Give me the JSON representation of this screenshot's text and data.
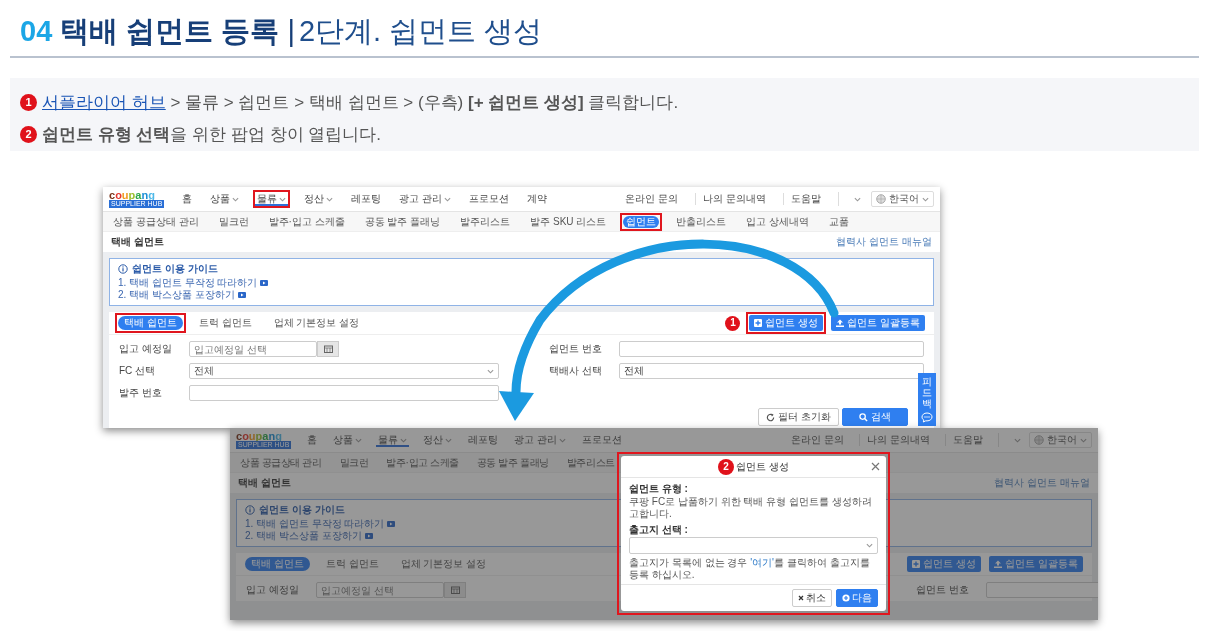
{
  "heading": {
    "number": "04",
    "title": "택배 쉽먼트 등록",
    "separator": "|",
    "subtitle": "2단계. 쉽먼트 생성"
  },
  "instructions": [
    {
      "marker": "1",
      "link": "서플라이어 허브",
      "text": " > 물류 > 쉽먼트 > 택배 쉽먼트 > (우측) **[+ 쉽먼트 생성]** 클릭합니다."
    },
    {
      "marker": "2",
      "text": "**쉽먼트 유형 선택**을 위한 팝업 창이 열립니다."
    }
  ],
  "screens": [
    {
      "dimmed": false,
      "logo": {
        "wordmark": "coupang",
        "badge": "SUPPLIER HUB"
      },
      "nav": [
        {
          "label": "홈",
          "dropdown": false,
          "selected": false,
          "highlighted": false
        },
        {
          "label": "상품",
          "dropdown": true,
          "selected": false,
          "highlighted": false
        },
        {
          "label": "물류",
          "dropdown": true,
          "selected": true,
          "highlighted": true
        },
        {
          "label": "정산",
          "dropdown": true,
          "selected": false,
          "highlighted": false
        },
        {
          "label": "레포팅",
          "dropdown": false,
          "selected": false,
          "highlighted": false
        },
        {
          "label": "광고 관리",
          "dropdown": true,
          "selected": false,
          "highlighted": false
        },
        {
          "label": "프로모션",
          "dropdown": false,
          "selected": false,
          "highlighted": false
        },
        {
          "label": "계약",
          "dropdown": false,
          "selected": false,
          "highlighted": false
        }
      ],
      "top_links": [
        "온라인 문의",
        "나의 문의내역",
        "도움말"
      ],
      "language": "한국어",
      "subnav": [
        {
          "label": "상품 공급상태 관리",
          "selected": false,
          "highlighted": false
        },
        {
          "label": "밀크런",
          "selected": false,
          "highlighted": false
        },
        {
          "label": "발주·입고 스케줄",
          "selected": false,
          "highlighted": false
        },
        {
          "label": "공동 발주 플래닝",
          "selected": false,
          "highlighted": false
        },
        {
          "label": "발주리스트",
          "selected": false,
          "highlighted": false
        },
        {
          "label": "발주 SKU 리스트",
          "selected": false,
          "highlighted": false
        },
        {
          "label": "쉽먼트",
          "selected": true,
          "highlighted": true
        },
        {
          "label": "반출리스트",
          "selected": false,
          "highlighted": false
        },
        {
          "label": "입고 상세내역",
          "selected": false,
          "highlighted": false
        },
        {
          "label": "교품",
          "selected": false,
          "highlighted": false
        }
      ],
      "page_title": "택배 쉽먼트",
      "manual_link": "협력사 쉽먼트 매뉴얼",
      "guide": {
        "title": "쉽먼트 이용 가이드",
        "items": [
          "1. 택배 쉽먼트 무작정 따라하기",
          "2. 택배 박스상품 포장하기"
        ]
      },
      "tabs": [
        {
          "label": "택배 쉽먼트",
          "selected": true,
          "highlighted": true
        },
        {
          "label": "트럭 쉽먼트",
          "selected": false,
          "highlighted": false
        },
        {
          "label": "업체 기본정보 설정",
          "selected": false,
          "highlighted": false
        }
      ],
      "step_marker": "1",
      "actions": [
        {
          "label": "쉽먼트 생성",
          "kind": "create",
          "highlighted": true
        },
        {
          "label": "쉽먼트 일괄등록",
          "kind": "upload",
          "highlighted": false
        }
      ],
      "left_fields": [
        {
          "label": "입고 예정일",
          "kind": "date",
          "placeholder": "입고예정일 선택"
        },
        {
          "label": "FC 선택",
          "kind": "select",
          "value": "전체"
        },
        {
          "label": "발주 번호",
          "kind": "text"
        }
      ],
      "right_fields": [
        {
          "label": "쉽먼트 번호",
          "kind": "text"
        },
        {
          "label": "택배사 선택",
          "kind": "text",
          "value": "전체"
        }
      ],
      "filter_buttons": [
        {
          "label": "필터 초기화",
          "kind": "reset"
        },
        {
          "label": "검색",
          "kind": "search"
        }
      ],
      "feedback_tab": "피드백"
    },
    {
      "dimmed": true,
      "logo": {
        "wordmark": "coupang",
        "badge": "SUPPLIER HUB"
      },
      "nav": [
        {
          "label": "홈",
          "dropdown": false,
          "selected": false,
          "highlighted": false
        },
        {
          "label": "상품",
          "dropdown": true,
          "selected": false,
          "highlighted": false
        },
        {
          "label": "물류",
          "dropdown": true,
          "selected": true,
          "highlighted": false
        },
        {
          "label": "정산",
          "dropdown": true,
          "selected": false,
          "highlighted": false
        },
        {
          "label": "레포팅",
          "dropdown": false,
          "selected": false,
          "highlighted": false
        },
        {
          "label": "광고 관리",
          "dropdown": true,
          "selected": false,
          "highlighted": false
        },
        {
          "label": "프로모션",
          "dropdown": false,
          "selected": false,
          "highlighted": false
        }
      ],
      "top_links": [
        "온라인 문의",
        "나의 문의내역",
        "도움말"
      ],
      "language": "한국어",
      "subnav": [
        {
          "label": "상품 공급상태 관리",
          "selected": false,
          "highlighted": false
        },
        {
          "label": "밀크런",
          "selected": false,
          "highlighted": false
        },
        {
          "label": "발주·입고 스케줄",
          "selected": false,
          "highlighted": false
        },
        {
          "label": "공동 발주 플래닝",
          "selected": false,
          "highlighted": false
        },
        {
          "label": "발주리스트",
          "selected": false,
          "highlighted": false
        }
      ],
      "page_title": "택배 쉽먼트",
      "manual_link": "협력사 쉽먼트 매뉴얼",
      "guide": {
        "title": "쉽먼트 이용 가이드",
        "items": [
          "1. 택배 쉽먼트 무작정 따라하기",
          "2. 택배 박스상품 포장하기"
        ]
      },
      "tabs": [
        {
          "label": "택배 쉽먼트",
          "selected": true,
          "highlighted": false
        },
        {
          "label": "트럭 쉽먼트",
          "selected": false,
          "highlighted": false
        },
        {
          "label": "업체 기본정보 설정",
          "selected": false,
          "highlighted": false
        }
      ],
      "actions": [
        {
          "label": "쉽먼트 생성",
          "kind": "create",
          "highlighted": false
        },
        {
          "label": "쉽먼트 일괄등록",
          "kind": "upload",
          "highlighted": false
        }
      ],
      "left_fields": [
        {
          "label": "입고 예정일",
          "kind": "date",
          "placeholder": "입고예정일 선택"
        }
      ],
      "right_fields": [
        {
          "label": "쉽먼트 번호",
          "kind": "text"
        }
      ],
      "modal": {
        "step_marker": "2",
        "title": "쉽먼트 생성",
        "highlighted": true,
        "type_label": "쉽먼트 유형 :",
        "type_text": "쿠팡 FC로 납품하기 위한 택배 유형 쉽먼트를 생성하려고합니다.",
        "origin_label": "출고지 선택 :",
        "note_before": "출고지가 목록에 없는 경우 ",
        "note_link": "'여기'",
        "note_after": "를 클릭하여 출고지를 등록 하십시오.",
        "buttons": [
          {
            "label": "취소",
            "kind": "cancel"
          },
          {
            "label": "다음",
            "kind": "next"
          }
        ]
      }
    }
  ]
}
